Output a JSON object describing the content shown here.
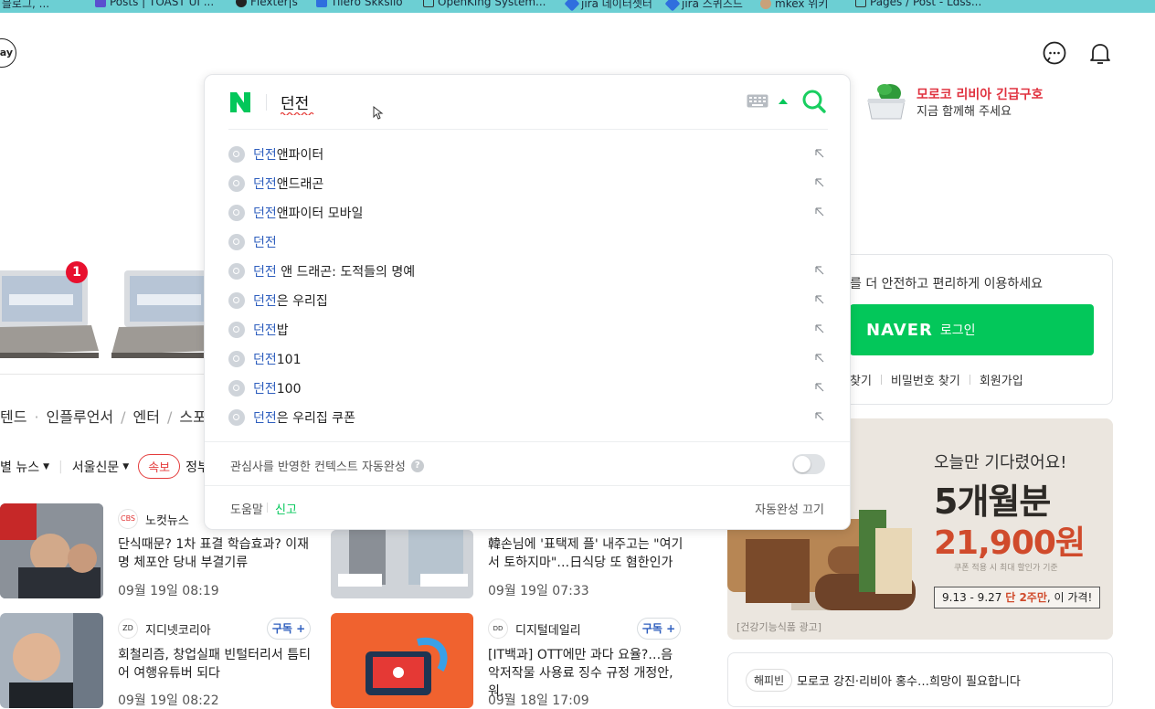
{
  "bookmarks": [
    "기발 블로그, ...",
    "Posts | TOAST UI ...",
    "Flexter|s",
    "Tilero Skkslio",
    "OpenKing System...",
    "jira 데이터셋터",
    "jira 스퀴즈드",
    "mkex 위키",
    "Pages / Post - Ldss..."
  ],
  "header": {
    "pay_label": "ay"
  },
  "search": {
    "query": "던전",
    "suggestions": [
      {
        "hl": "던전",
        "rest": "앤파이터",
        "arrow": true
      },
      {
        "hl": "던전",
        "rest": "앤드래곤",
        "arrow": true
      },
      {
        "hl": "던전",
        "rest": "앤파이터 모바일",
        "arrow": true
      },
      {
        "hl": "던전",
        "rest": "",
        "arrow": false
      },
      {
        "hl": "던전",
        "rest": " 앤 드래곤: 도적들의 명예",
        "arrow": true
      },
      {
        "hl": "던전",
        "rest": "은 우리집",
        "arrow": true
      },
      {
        "hl": "던전",
        "rest": "밥",
        "arrow": true
      },
      {
        "hl": "던전",
        "rest": "101",
        "arrow": true
      },
      {
        "hl": "던전",
        "rest": "100",
        "arrow": true
      },
      {
        "hl": "던전",
        "rest": "은 우리집 쿠폰",
        "arrow": true
      }
    ],
    "context_label": "관심사를 반영한 컨텍스트 자동완성",
    "help": "도움말",
    "report": "신고",
    "autocomplete_off": "자동완성 끄기"
  },
  "notice": {
    "title": "모로코 리비아 긴급구호",
    "subtitle": "지금 함께해 주세요"
  },
  "shopping": {
    "badge": "1"
  },
  "news": {
    "categories": [
      "텐드",
      "인플루언서",
      "엔터",
      "스포"
    ],
    "press_label": "별 뉴스",
    "press_name": "서울신문",
    "breaking": "속보",
    "press_extra": "정부",
    "items": [
      {
        "source": "노컷뉴스",
        "title": "단식때문? 1차 표결 학습효과? 이재명 체포안 당내 부결기류",
        "time": "09월 19일 08:19"
      },
      {
        "source": "",
        "title": "韓손님에 '표택제 플' 내주고는 \"여기서 토하지마\"…日식당 또 혐한인가",
        "time": "09월 19일 07:33"
      },
      {
        "source": "지디넷코리아",
        "title": "회철리즘, 창업실패 빈털터리서 틈티어 여행유튜버 되다",
        "time": "09월 19일 08:22",
        "subscribe": "구독"
      },
      {
        "source": "디지털데일리",
        "title": "[IT백과] OTT에만 과다 요율?…음악저작물 사용료 징수 규정 개정안, 워…",
        "time": "09월 18일 17:09",
        "subscribe": "구독"
      }
    ]
  },
  "login": {
    "message": "를 더 안전하고 편리하게 이용하세요",
    "brand": "NAVER",
    "button": "로그인",
    "links": [
      "찾기",
      "비밀번호 찾기",
      "회원가입"
    ]
  },
  "ad": {
    "line1": "오늘만 기다렸어요!",
    "line2": "5개월분",
    "line3": "21,900원",
    "line4": "쿠폰 적용 시 최대 할인가 기준",
    "date": "9.13 - 9.27",
    "bold": "단 2주만",
    "tail": ", 이 가격!",
    "tag": "[건강기능식품 광고]"
  },
  "happybean": {
    "pill": "해피빈",
    "text": "모로코 강진·리비아 홍수…희망이 필요합니다"
  },
  "colors": {
    "naver_green": "#03c75a",
    "highlight_blue": "#2f5fbe",
    "alert_red": "#e0323f"
  }
}
